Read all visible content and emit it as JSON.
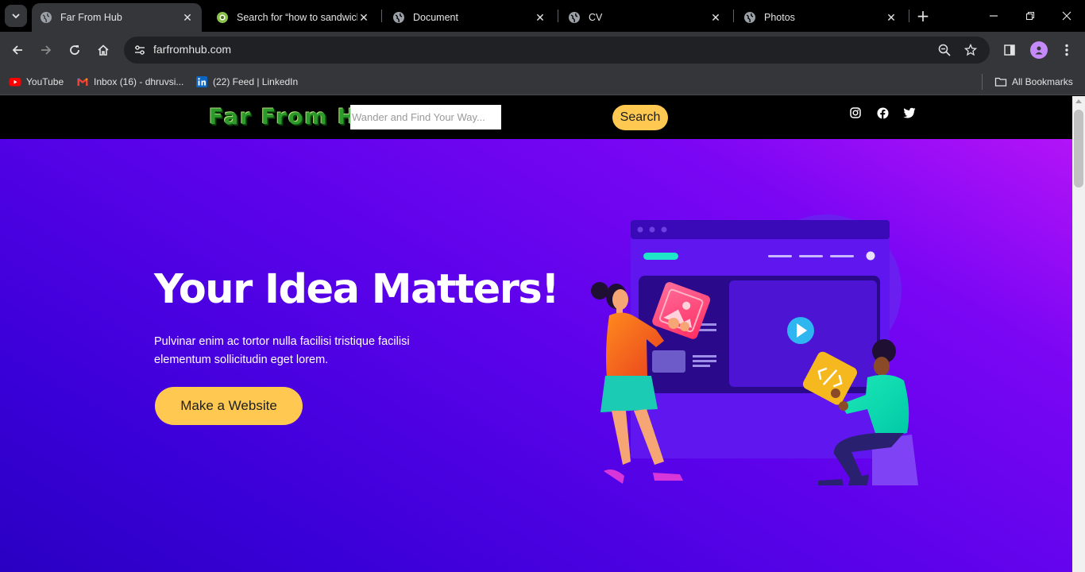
{
  "browser": {
    "tabs": [
      {
        "title": "Far From Hub",
        "active": true,
        "favicon": "globe-icon"
      },
      {
        "title": "Search for “how to sandwich",
        "active": false,
        "favicon": "search-favicon-icon"
      },
      {
        "title": "Document",
        "active": false,
        "favicon": "globe-icon"
      },
      {
        "title": "CV",
        "active": false,
        "favicon": "globe-icon"
      },
      {
        "title": "Photos",
        "active": false,
        "favicon": "globe-icon"
      }
    ],
    "url": "farfromhub.com",
    "bookmarks": [
      {
        "label": "YouTube",
        "icon": "youtube-icon"
      },
      {
        "label": "Inbox (16) - dhruvsi...",
        "icon": "gmail-icon"
      },
      {
        "label": "(22) Feed | LinkedIn",
        "icon": "linkedin-icon"
      }
    ],
    "all_bookmarks_label": "All Bookmarks"
  },
  "site": {
    "logo_text": "Far From Hub",
    "search_placeholder": "Wander and Find Your Way...",
    "search_button": "Search",
    "social": [
      "instagram-icon",
      "facebook-icon",
      "twitter-icon"
    ]
  },
  "hero": {
    "title": "Your Idea Matters!",
    "text": "Pulvinar enim ac tortor nulla facilisi tristique facilisi elementum sollicitudin eget lorem.",
    "cta": "Make a Website"
  },
  "colors": {
    "accent": "#ffc850",
    "hero_gradient_start": "#b313f7",
    "hero_gradient_end": "#2a00c2"
  }
}
